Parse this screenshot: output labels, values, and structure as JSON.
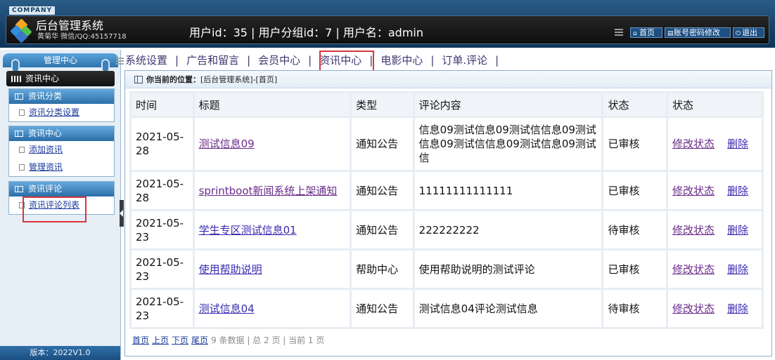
{
  "header": {
    "company": "COMPANY",
    "title": "后台管理系统",
    "subtitle": "黄菊华 微信/QQ:45157718",
    "user_info": "用户id：35 | 用户分组id：7 | 用户名：admin",
    "buttons": {
      "home": "首页",
      "password": "账号密码修改",
      "logout": "退出"
    }
  },
  "sidebar": {
    "top_label": "管理中心",
    "section": "资讯中心",
    "groups": [
      {
        "title": "资讯分类",
        "items": [
          "资讯分类设置"
        ]
      },
      {
        "title": "资讯中心",
        "items": [
          "添加资讯",
          "管理资讯"
        ]
      },
      {
        "title": "资讯评论",
        "items": [
          "资讯评论列表"
        ]
      }
    ],
    "version": "版本：2022V1.0"
  },
  "nav": {
    "items": [
      "系统设置",
      "广告和留言",
      "会员中心",
      "资讯中心",
      "电影中心",
      "订单.评论"
    ],
    "active": "资讯中心"
  },
  "breadcrumb": {
    "label": "你当前的位置：",
    "path": "[后台管理系统]-[首页]"
  },
  "table": {
    "headers": [
      "时间",
      "标题",
      "类型",
      "评论内容",
      "状态",
      "状态"
    ],
    "rows": [
      {
        "time": "2021-05-28",
        "title": "测试信息09",
        "type": "通知公告",
        "content": "信息09测试信息09测试信信息09测试信息09测试信信息09测试信息09测试信",
        "status": "已审核",
        "edit": "修改状态",
        "delete": "删除"
      },
      {
        "time": "2021-05-28",
        "title": "sprintboot新闻系统上架通知",
        "type": "通知公告",
        "content": "11111111111111",
        "status": "已审核",
        "edit": "修改状态",
        "delete": "删除"
      },
      {
        "time": "2021-05-23",
        "title": "学生专区测试信息01",
        "type": "通知公告",
        "content": "222222222",
        "status": "待审核",
        "edit": "修改状态",
        "delete": "删除"
      },
      {
        "time": "2021-05-23",
        "title": "使用帮助说明",
        "type": "帮助中心",
        "content": "使用帮助说明的测试评论",
        "status": "已审核",
        "edit": "修改状态",
        "delete": "删除"
      },
      {
        "time": "2021-05-23",
        "title": "测试信息04",
        "type": "通知公告",
        "content": "测试信息04评论测试信息",
        "status": "待审核",
        "edit": "修改状态",
        "delete": "删除"
      }
    ]
  },
  "pager": {
    "first": "首页",
    "prev": "上页",
    "next": "下页",
    "last": "尾页",
    "summary": "9 条数据 | 总 2 页 | 当前 1 页"
  },
  "colors": {
    "header_bg": "#16436b",
    "accent": "#2e73ad",
    "pending": "#d0281c",
    "highlight_box": "#d8363a"
  }
}
